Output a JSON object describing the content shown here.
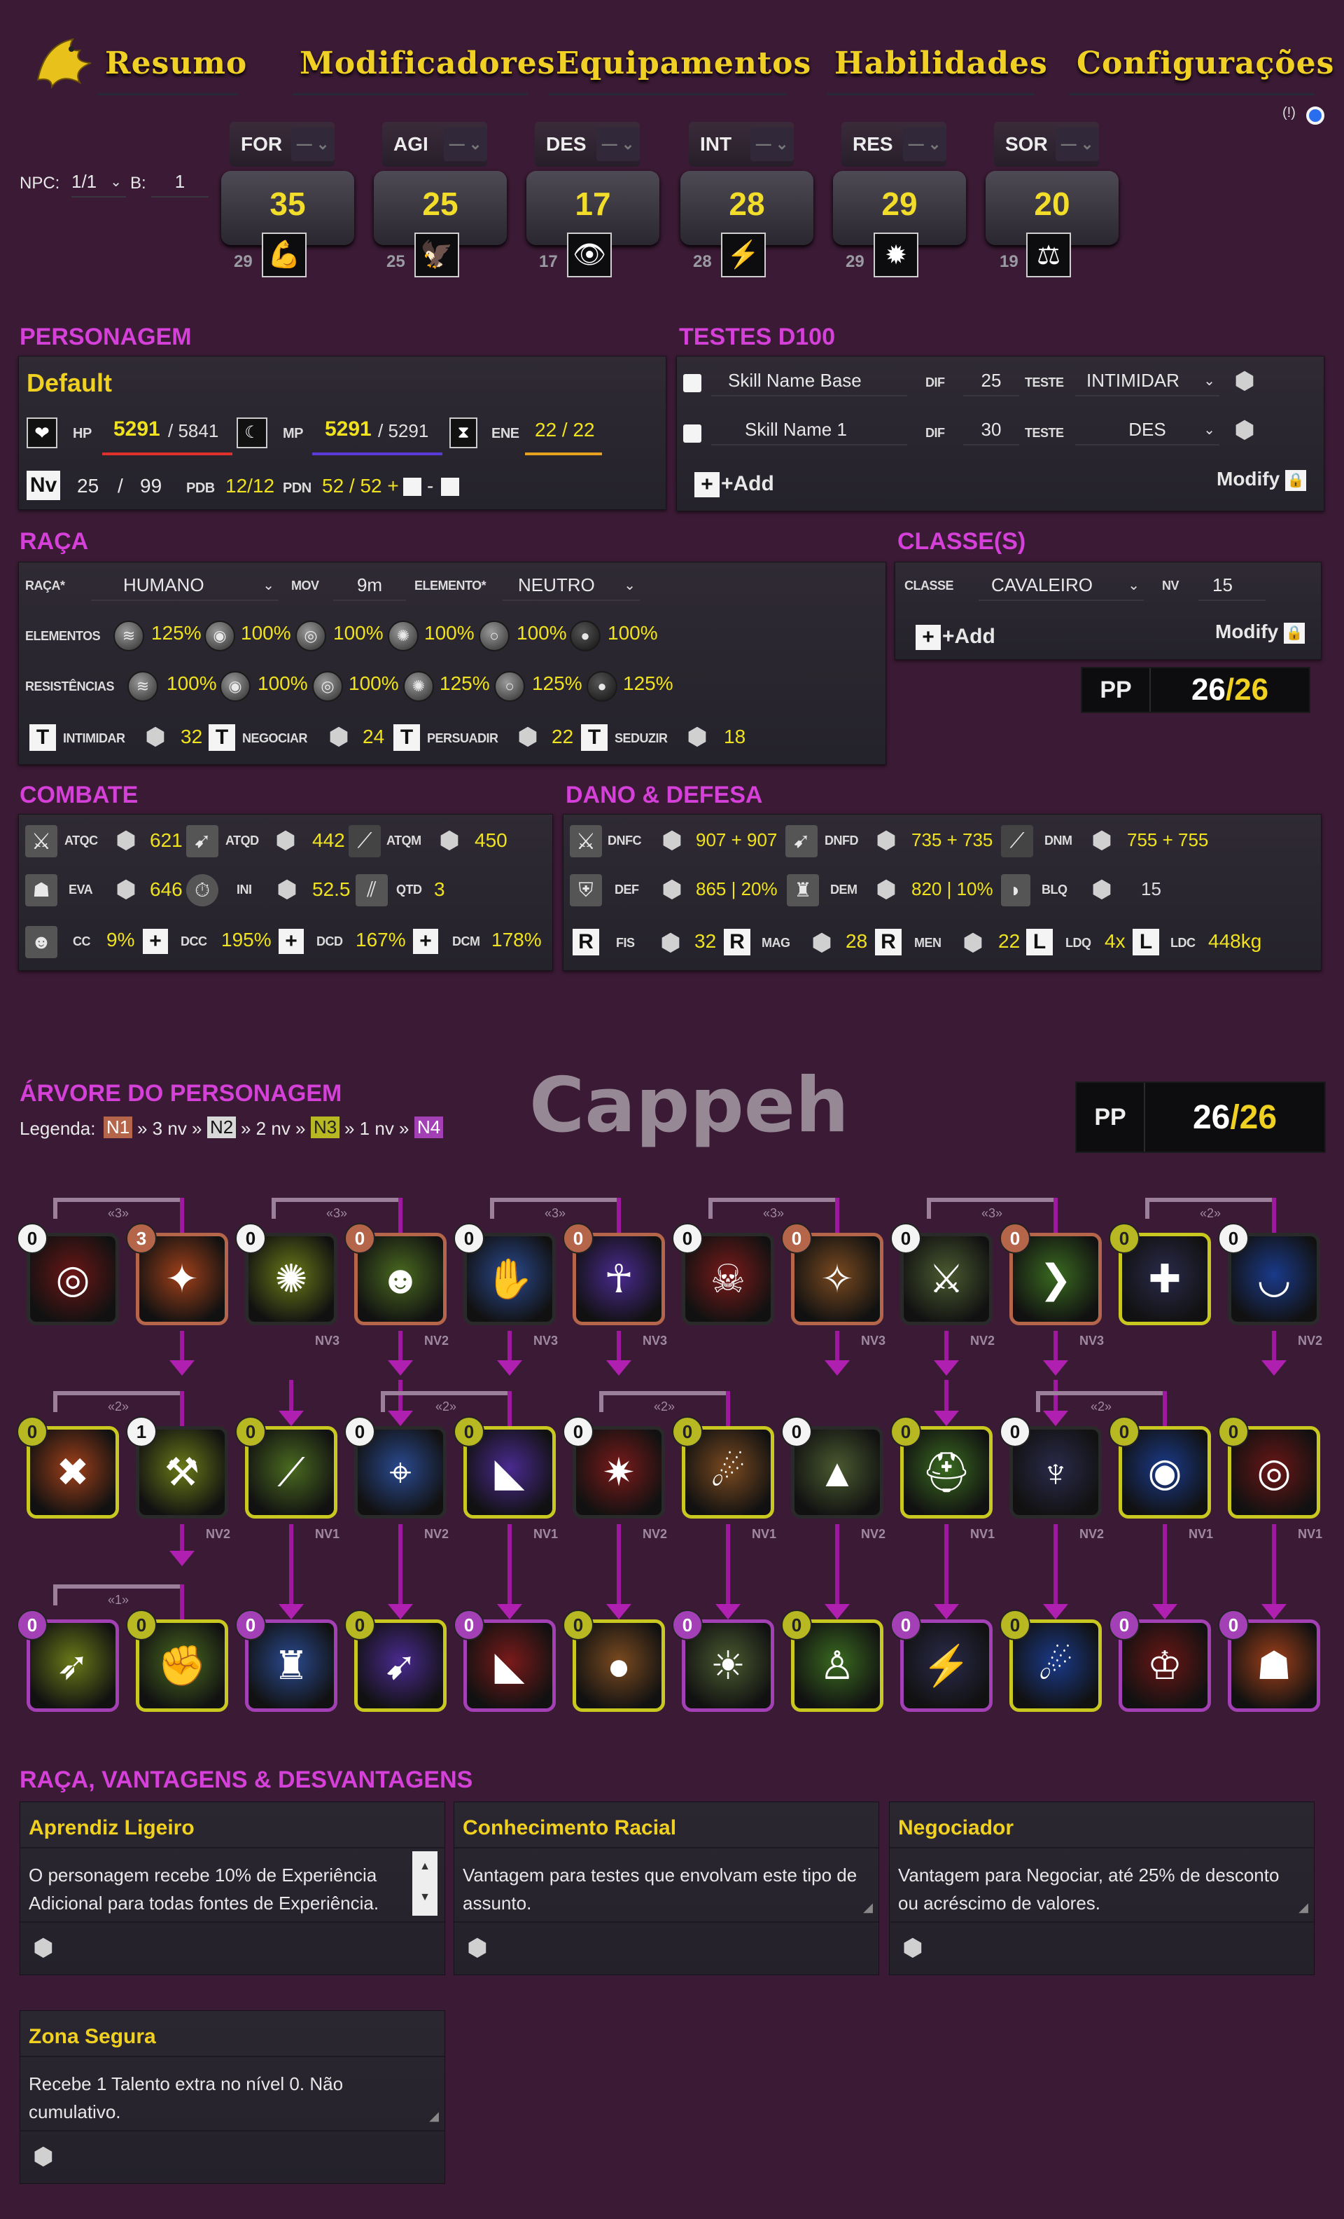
{
  "tabs": [
    {
      "label": "Resumo"
    },
    {
      "label": "Modificadores"
    },
    {
      "label": "Equipamentos"
    },
    {
      "label": "Habilidades"
    },
    {
      "label": "Configurações"
    }
  ],
  "info_marker": "(!)",
  "npc": {
    "label": "NPC:",
    "value": "1/1",
    "b_label": "B:",
    "b_value": "1"
  },
  "attributes": [
    {
      "name": "FOR",
      "value": "35",
      "base": "29",
      "icon": "strength-icon"
    },
    {
      "name": "AGI",
      "value": "25",
      "base": "25",
      "icon": "wings-icon"
    },
    {
      "name": "DES",
      "value": "17",
      "base": "17",
      "icon": "eye-icon"
    },
    {
      "name": "INT",
      "value": "28",
      "base": "28",
      "icon": "intellect-icon"
    },
    {
      "name": "RES",
      "value": "29",
      "base": "29",
      "icon": "resistance-icon"
    },
    {
      "name": "SOR",
      "value": "20",
      "base": "19",
      "icon": "scales-icon"
    }
  ],
  "personagem": {
    "title": "PERSONAGEM",
    "name": "Default",
    "hp_label": "HP",
    "hp": "5291",
    "hp_max": "/ 5841",
    "mp_label": "MP",
    "mp": "5291",
    "mp_max": "/ 5291",
    "ene_label": "ENE",
    "ene": "22 / 22",
    "nv_label": "Nv",
    "nv": "25",
    "nv_sep": "/",
    "nv_max": "99",
    "pdb_label": "PDB",
    "pdb": "12/12",
    "pdn_label": "PDN",
    "pdn": "52 / 52 +",
    "pdn_sep": "-",
    "colors": {
      "hp": "#e0302c",
      "mp": "#5a3ad8",
      "ene": "#e8a020"
    }
  },
  "testes": {
    "title": "TESTES D100",
    "rows": [
      {
        "name": "Skill Name Base",
        "dif_label": "DIF",
        "dif": "25",
        "teste_label": "TESTE",
        "teste": "INTIMIDAR"
      },
      {
        "name": "Skill Name 1",
        "dif_label": "DIF",
        "dif": "30",
        "teste_label": "TESTE",
        "teste": "DES"
      }
    ],
    "add": "+Add",
    "modify": "Modify"
  },
  "raca": {
    "title": "RAÇA",
    "raca_label": "RAÇA*",
    "raca": "HUMANO",
    "mov_label": "MOV",
    "mov": "9m",
    "elemento_label": "ELEMENTO*",
    "elemento": "NEUTRO",
    "elementos_label": "ELEMENTOS",
    "elementos": [
      "125%",
      "100%",
      "100%",
      "100%",
      "100%",
      "100%"
    ],
    "resist_label": "RESISTÊNCIAS",
    "resist": [
      "100%",
      "100%",
      "100%",
      "125%",
      "125%",
      "125%"
    ],
    "social": [
      {
        "type": "T",
        "label": "INTIMIDAR",
        "value": "32"
      },
      {
        "type": "T",
        "label": "NEGOCIAR",
        "value": "24"
      },
      {
        "type": "T",
        "label": "PERSUADIR",
        "value": "22"
      },
      {
        "type": "T",
        "label": "SEDUZIR",
        "value": "18"
      }
    ]
  },
  "classe": {
    "title": "CLASSE(S)",
    "classe_label": "CLASSE",
    "classe": "CAVALEIRO",
    "nv_label": "NV",
    "nv": "15",
    "add": "+Add",
    "modify": "Modify",
    "pp_label": "PP",
    "pp": "26",
    "pp_max": "/26"
  },
  "combate": {
    "title": "COMBATE",
    "row1": [
      {
        "label": "ATQC",
        "value": "621"
      },
      {
        "label": "ATQD",
        "value": "442"
      },
      {
        "label": "ATQM",
        "value": "450"
      }
    ],
    "row2": [
      {
        "label": "EVA",
        "value": "646"
      },
      {
        "label": "INI",
        "value": "52.5"
      },
      {
        "label": "QTD",
        "value": "3"
      }
    ],
    "row3": [
      {
        "label": "CC",
        "value": "9%"
      },
      {
        "label": "DCC",
        "value": "195%"
      },
      {
        "label": "DCD",
        "value": "167%"
      },
      {
        "label": "DCM",
        "value": "178%"
      }
    ]
  },
  "dano": {
    "title": "DANO & DEFESA",
    "row1": [
      {
        "label": "DNFC",
        "value": "907 + 907"
      },
      {
        "label": "DNFD",
        "value": "735 + 735"
      },
      {
        "label": "DNM",
        "value": "755 + 755"
      }
    ],
    "row2": [
      {
        "label": "DEF",
        "value": "865 | 20%"
      },
      {
        "label": "DEM",
        "value": "820 | 10%"
      },
      {
        "label": "BLQ",
        "value": "15"
      }
    ],
    "row3": [
      {
        "type": "R",
        "label": "FIS",
        "value": "32"
      },
      {
        "type": "R",
        "label": "MAG",
        "value": "28"
      },
      {
        "type": "R",
        "label": "MEN",
        "value": "22"
      },
      {
        "type": "L",
        "label": "LDQ",
        "value": "4x"
      },
      {
        "type": "L",
        "label": "LDC",
        "value": "448kg"
      }
    ]
  },
  "arvore": {
    "title": "ÁRVORE DO PERSONAGEM",
    "legend_label": "Legenda:",
    "legend": [
      {
        "tag": "N1",
        "text": "» 3 nv »"
      },
      {
        "tag": "N2",
        "text": "» 2 nv »"
      },
      {
        "tag": "N3",
        "text": "» 1 nv »"
      },
      {
        "tag": "N4",
        "text": ""
      }
    ],
    "watermark": "Cappeh",
    "pp_label": "PP",
    "pp": "26",
    "pp_max": "/26",
    "group_labels": [
      "«3»",
      "«3»",
      "«3»",
      "«3»",
      "«3»",
      "«2»",
      "«2»",
      "«2»",
      "«2»",
      "«2»",
      "«1»"
    ],
    "row1": [
      {
        "badge": "0",
        "bc": "w",
        "icon": "target-body-icon"
      },
      {
        "badge": "3",
        "bc": "o",
        "icon": "fire-body-icon"
      },
      {
        "badge": "0",
        "bc": "w",
        "icon": "burst-icon",
        "nv": "NV3"
      },
      {
        "badge": "0",
        "bc": "o",
        "icon": "aura-icon",
        "nv": "NV2"
      },
      {
        "badge": "0",
        "bc": "w",
        "icon": "holy-hand-icon",
        "nv": "NV3"
      },
      {
        "badge": "0",
        "bc": "o",
        "icon": "arcane-body-icon",
        "nv": "NV3"
      },
      {
        "badge": "0",
        "bc": "w",
        "icon": "skeleton-icon"
      },
      {
        "badge": "0",
        "bc": "o",
        "icon": "slash-icon",
        "nv": "NV3"
      },
      {
        "badge": "0",
        "bc": "w",
        "icon": "warrior-icon",
        "nv": "NV2"
      },
      {
        "badge": "0",
        "bc": "o",
        "icon": "armor-icon",
        "nv": "NV3"
      },
      {
        "badge": "0",
        "bc": "y",
        "icon": "shield-plus-icon"
      },
      {
        "badge": "0",
        "bc": "w",
        "icon": "horizon-icon",
        "nv": "NV2"
      }
    ],
    "row2": [
      {
        "badge": "0",
        "bc": "y",
        "icon": "cross-swords-icon"
      },
      {
        "badge": "1",
        "bc": "w",
        "icon": "fire-axe-icon",
        "nv": "NV2"
      },
      {
        "badge": "0",
        "bc": "y",
        "icon": "blade-icon",
        "nv": "NV1"
      },
      {
        "badge": "0",
        "bc": "w",
        "icon": "crosshair-icon",
        "nv": "NV2"
      },
      {
        "badge": "0",
        "bc": "y",
        "icon": "strike-icon",
        "nv": "NV1"
      },
      {
        "badge": "0",
        "bc": "w",
        "icon": "vortex-icon",
        "nv": "NV2"
      },
      {
        "badge": "0",
        "bc": "y",
        "icon": "flame-icon",
        "nv": "NV1"
      },
      {
        "badge": "0",
        "bc": "w",
        "icon": "beast-icon",
        "nv": "NV2"
      },
      {
        "badge": "0",
        "bc": "y",
        "icon": "helmet-icon",
        "nv": "NV1"
      },
      {
        "badge": "0",
        "bc": "w",
        "icon": "flex-icon",
        "nv": "NV2"
      },
      {
        "badge": "0",
        "bc": "y",
        "icon": "silhouette-icon",
        "nv": "NV1"
      },
      {
        "badge": "0",
        "bc": "y",
        "icon": "eye-vision-icon",
        "nv": "NV1"
      }
    ],
    "row3": [
      {
        "badge": "0",
        "bc": "p",
        "icon": "spear-icon"
      },
      {
        "badge": "0",
        "bc": "y",
        "icon": "fist-icon"
      },
      {
        "badge": "0",
        "bc": "p",
        "icon": "shadow-icon"
      },
      {
        "badge": "0",
        "bc": "y",
        "icon": "arrow-icon"
      },
      {
        "badge": "0",
        "bc": "p",
        "icon": "dark-strike-icon"
      },
      {
        "badge": "0",
        "bc": "y",
        "icon": "orb-icon"
      },
      {
        "badge": "0",
        "bc": "p",
        "icon": "sun-icon"
      },
      {
        "badge": "0",
        "bc": "y",
        "icon": "figure-icon"
      },
      {
        "badge": "0",
        "bc": "p",
        "icon": "lightning-icon"
      },
      {
        "badge": "0",
        "bc": "y",
        "icon": "dodge-icon"
      },
      {
        "badge": "0",
        "bc": "p",
        "icon": "crown-icon"
      },
      {
        "badge": "0",
        "bc": "p",
        "icon": "ghost-icon"
      }
    ]
  },
  "vantagens": {
    "title": "RAÇA, VANTAGENS & DESVANTAGENS",
    "cards": [
      {
        "title": "Aprendiz Ligeiro",
        "text": "O personagem recebe 10% de Experiência Adicional para todas fontes de Experiência."
      },
      {
        "title": "Conhecimento Racial",
        "text": "Vantagem para testes que envolvam este tipo de assunto."
      },
      {
        "title": "Negociador",
        "text": "Vantagem para Negociar, até 25% de desconto ou acréscimo de valores."
      },
      {
        "title": "Zona Segura",
        "text": "Recebe 1 Talento extra no nível 0. Não cumulativo."
      }
    ]
  }
}
